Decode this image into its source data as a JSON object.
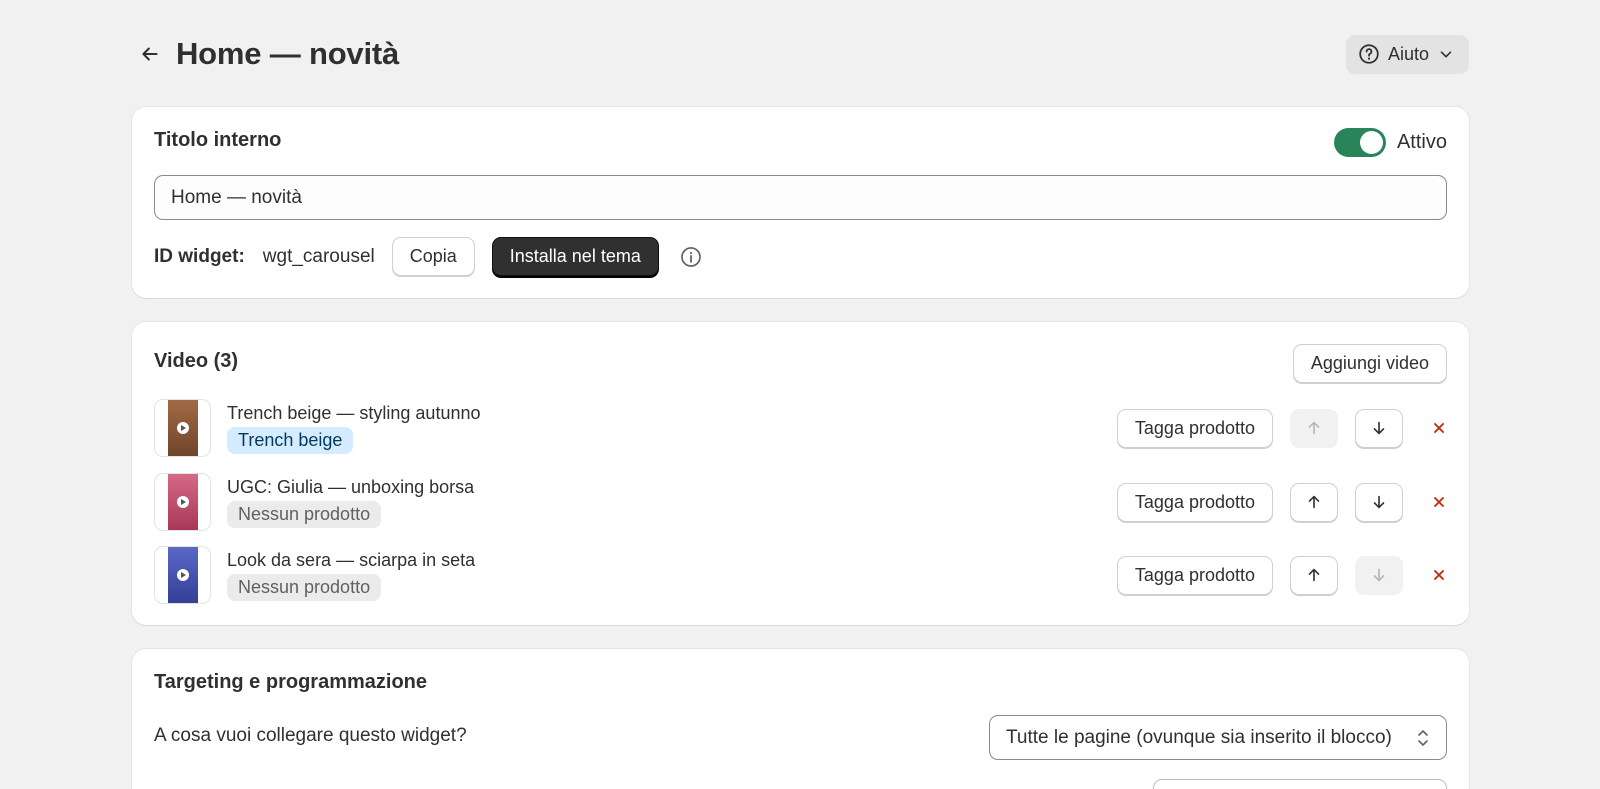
{
  "header": {
    "title": "Home — novità",
    "help_label": "Aiuto"
  },
  "general": {
    "title": "Titolo interno",
    "active_label": "Attivo",
    "active": true,
    "title_value": "Home — novità",
    "id_label": "ID widget:",
    "id_value": "wgt_carousel",
    "copy_label": "Copia",
    "install_label": "Installa nel tema"
  },
  "videos": {
    "title": "Video (3)",
    "add_label": "Aggiungi video",
    "tag_label": "Tagga prodotto",
    "items": [
      {
        "title": "Trench beige — styling autunno",
        "product": "Trench beige",
        "tagged": true,
        "thumb_color": "#8b5a3c",
        "up_enabled": false,
        "down_enabled": true
      },
      {
        "title": "UGC: Giulia — unboxing borsa",
        "product": "Nessun prodotto",
        "tagged": false,
        "thumb_color": "#c4506e",
        "up_enabled": true,
        "down_enabled": true
      },
      {
        "title": "Look da sera — sciarpa in seta",
        "product": "Nessun prodotto",
        "tagged": false,
        "thumb_color": "#4a55b0",
        "up_enabled": true,
        "down_enabled": false
      }
    ]
  },
  "targeting": {
    "title": "Targeting e programmazione",
    "link_question": "A cosa vuoi collegare questo widget?",
    "link_value": "Tutte le pagine (ovunque sia inserito il blocco)"
  },
  "colors": {
    "accent_green": "#29845a",
    "dark_button": "#303030",
    "delete_red": "#c5280c",
    "badge_blue": "#d5ebff"
  }
}
